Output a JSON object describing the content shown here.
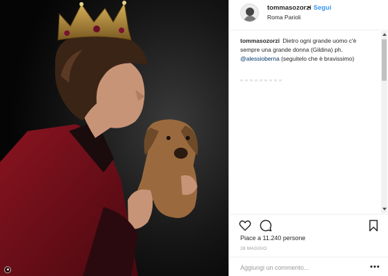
{
  "header": {
    "username": "tommasozorzi",
    "separator": "•",
    "follow_label": "Segui",
    "location": "Roma Parioli"
  },
  "caption": {
    "username": "tommasozorzi",
    "text_1": "Dietro ogni grande uomo c'è sempre una grande donna (Gildina) ph.",
    "mention": "@alessioberna",
    "text_2": "(seguitelo che è bravissimo)"
  },
  "stats": {
    "likes": "Piace a 11.240 persone",
    "date": "28 MAGGIO"
  },
  "comment_box": {
    "placeholder": "Aggiungi un commento...",
    "more_label": "•••"
  },
  "icons": {
    "like": "heart-icon",
    "comment": "comment-icon",
    "save": "bookmark-icon",
    "tag": "user-tag-icon"
  },
  "colors": {
    "link": "#3897f0",
    "mention": "#003569",
    "text": "#262626",
    "muted": "#999999",
    "border": "#efefef"
  }
}
